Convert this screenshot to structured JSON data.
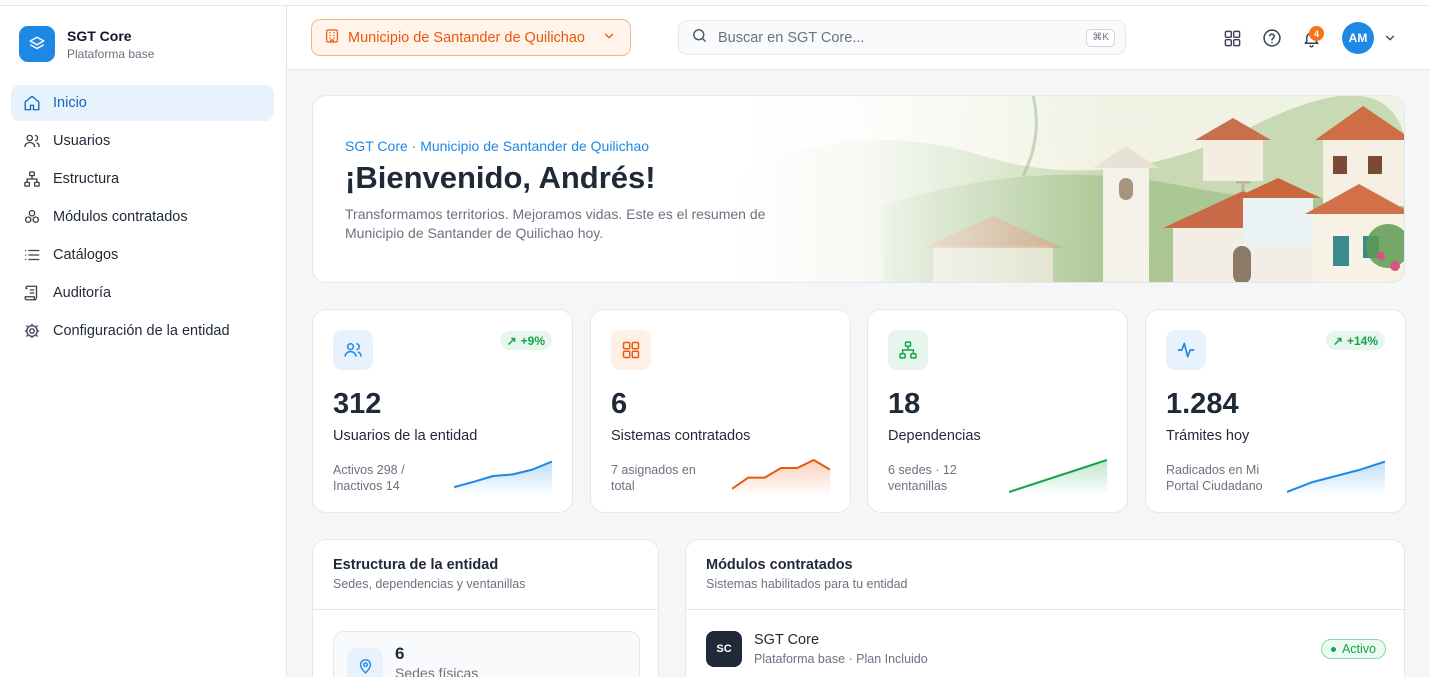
{
  "brand": {
    "title": "SGT Core",
    "subtitle": "Plataforma base"
  },
  "nav": [
    {
      "label": "Inicio",
      "icon": "home-icon",
      "active": true
    },
    {
      "label": "Usuarios",
      "icon": "users-icon"
    },
    {
      "label": "Estructura",
      "icon": "sitemap-icon"
    },
    {
      "label": "Módulos contratados",
      "icon": "modules-icon"
    },
    {
      "label": "Catálogos",
      "icon": "list-icon"
    },
    {
      "label": "Auditoría",
      "icon": "audit-icon"
    },
    {
      "label": "Configuración de la entidad",
      "icon": "gear-icon"
    }
  ],
  "header": {
    "entity": "Municipio de Santander de Quilichao",
    "search_placeholder": "Buscar en SGT Core...",
    "search_shortcut": "⌘K",
    "notifications_count": "4",
    "avatar_initials": "AM"
  },
  "hero": {
    "kicker": "SGT Core · Municipio de Santander de Quilichao",
    "title": "¡Bienvenido, Andrés!",
    "description": "Transformamos territorios. Mejoramos vidas. Este es el resumen de Municipio de Santander de Quilichao hoy."
  },
  "stats": [
    {
      "value": "312",
      "label": "Usuarios de la entidad",
      "note": "Activos 298 / Inactivos 14",
      "trend": "+9%",
      "icon": "users-icon",
      "color": "#1e88e5",
      "bg": "#e8f2fd",
      "spark": [
        0.15,
        0.32,
        0.5,
        0.55,
        0.7,
        0.95
      ]
    },
    {
      "value": "6",
      "label": "Sistemas contratados",
      "note": "7 asignados en total",
      "trend": "",
      "icon": "grid-icon",
      "color": "#ea580c",
      "bg": "#fff0e6",
      "spark": [
        0.1,
        0.45,
        0.45,
        0.75,
        0.75,
        1.0,
        0.7
      ]
    },
    {
      "value": "18",
      "label": "Dependencias",
      "note": "6 sedes · 12 ventanillas",
      "trend": "",
      "icon": "sitemap-icon",
      "color": "#16a34a",
      "bg": "#e6f6ec",
      "spark": [
        0.0,
        0.25,
        0.5,
        0.75,
        1.0
      ]
    },
    {
      "value": "1.284",
      "label": "Trámites hoy",
      "note": "Radicados en Mi Portal Ciudadano",
      "trend": "+14%",
      "icon": "activity-icon",
      "color": "#1e88e5",
      "bg": "#e8f2fd",
      "spark": [
        0.0,
        0.3,
        0.5,
        0.7,
        0.95
      ]
    }
  ],
  "structure_panel": {
    "title": "Estructura de la entidad",
    "subtitle": "Sedes, dependencias y ventanillas",
    "sedes_value": "6",
    "sedes_label": "Sedes físicas"
  },
  "modules_panel": {
    "title": "Módulos contratados",
    "subtitle": "Sistemas habilitados para tu entidad",
    "items": [
      {
        "initials": "SC",
        "name": "SGT Core",
        "desc": "Plataforma base · Plan Incluido",
        "status": "Activo"
      }
    ]
  }
}
